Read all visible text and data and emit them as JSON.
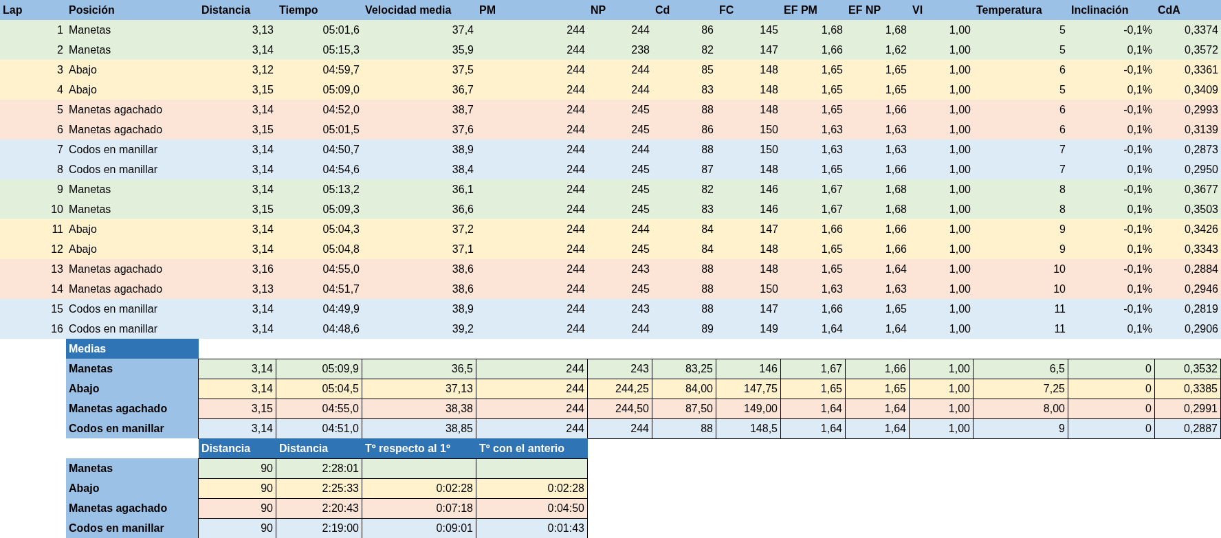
{
  "columns": [
    "Lap",
    "Posición",
    "Distancia",
    "Tiempo",
    "Velocidad media",
    "PM",
    "NP",
    "Cd",
    "FC",
    "EF PM",
    "EF NP",
    "VI",
    "Temperatura",
    "Inclinación",
    "CdA"
  ],
  "laps": [
    {
      "color": "#e2efda",
      "cells": [
        "1",
        "Manetas",
        "3,13",
        "05:01,6",
        "37,4",
        "244",
        "244",
        "86",
        "145",
        "1,68",
        "1,68",
        "1,00",
        "5",
        "-0,1%",
        "0,3374"
      ]
    },
    {
      "color": "#e2efda",
      "cells": [
        "2",
        "Manetas",
        "3,14",
        "05:15,3",
        "35,9",
        "244",
        "238",
        "82",
        "147",
        "1,66",
        "1,62",
        "1,00",
        "5",
        "0,1%",
        "0,3572"
      ]
    },
    {
      "color": "#fff2cc",
      "cells": [
        "3",
        "Abajo",
        "3,12",
        "04:59,7",
        "37,5",
        "244",
        "244",
        "85",
        "148",
        "1,65",
        "1,65",
        "1,00",
        "6",
        "-0,1%",
        "0,3361"
      ]
    },
    {
      "color": "#fff2cc",
      "cells": [
        "4",
        "Abajo",
        "3,15",
        "05:09,0",
        "36,7",
        "244",
        "244",
        "83",
        "148",
        "1,65",
        "1,65",
        "1,00",
        "5",
        "0,1%",
        "0,3409"
      ]
    },
    {
      "color": "#fce4d6",
      "cells": [
        "5",
        "Manetas agachado",
        "3,14",
        "04:52,0",
        "38,7",
        "244",
        "245",
        "88",
        "148",
        "1,65",
        "1,66",
        "1,00",
        "6",
        "-0,1%",
        "0,2993"
      ]
    },
    {
      "color": "#fce4d6",
      "cells": [
        "6",
        "Manetas agachado",
        "3,15",
        "05:01,5",
        "37,6",
        "244",
        "245",
        "86",
        "150",
        "1,63",
        "1,63",
        "1,00",
        "6",
        "0,1%",
        "0,3139"
      ]
    },
    {
      "color": "#ddebf7",
      "cells": [
        "7",
        "Codos en manillar",
        "3,14",
        "04:50,7",
        "38,9",
        "244",
        "244",
        "88",
        "150",
        "1,63",
        "1,63",
        "1,00",
        "7",
        "-0,1%",
        "0,2873"
      ]
    },
    {
      "color": "#ddebf7",
      "cells": [
        "8",
        "Codos en manillar",
        "3,14",
        "04:54,6",
        "38,4",
        "244",
        "245",
        "87",
        "148",
        "1,65",
        "1,66",
        "1,00",
        "7",
        "0,1%",
        "0,2950"
      ]
    },
    {
      "color": "#e2efda",
      "cells": [
        "9",
        "Manetas",
        "3,14",
        "05:13,2",
        "36,1",
        "244",
        "245",
        "82",
        "146",
        "1,67",
        "1,68",
        "1,00",
        "8",
        "-0,1%",
        "0,3677"
      ]
    },
    {
      "color": "#e2efda",
      "cells": [
        "10",
        "Manetas",
        "3,15",
        "05:09,3",
        "36,6",
        "244",
        "245",
        "83",
        "146",
        "1,67",
        "1,68",
        "1,00",
        "8",
        "0,1%",
        "0,3503"
      ]
    },
    {
      "color": "#fff2cc",
      "cells": [
        "11",
        "Abajo",
        "3,14",
        "05:04,3",
        "37,2",
        "244",
        "244",
        "84",
        "147",
        "1,66",
        "1,66",
        "1,00",
        "9",
        "-0,1%",
        "0,3426"
      ]
    },
    {
      "color": "#fff2cc",
      "cells": [
        "12",
        "Abajo",
        "3,14",
        "05:04,8",
        "37,1",
        "244",
        "245",
        "84",
        "148",
        "1,65",
        "1,66",
        "1,00",
        "9",
        "0,1%",
        "0,3343"
      ]
    },
    {
      "color": "#fce4d6",
      "cells": [
        "13",
        "Manetas agachado",
        "3,16",
        "04:55,0",
        "38,6",
        "244",
        "243",
        "88",
        "148",
        "1,65",
        "1,64",
        "1,00",
        "10",
        "-0,1%",
        "0,2884"
      ]
    },
    {
      "color": "#fce4d6",
      "cells": [
        "14",
        "Manetas agachado",
        "3,13",
        "04:51,7",
        "38,6",
        "244",
        "245",
        "88",
        "150",
        "1,63",
        "1,63",
        "1,00",
        "10",
        "0,1%",
        "0,2946"
      ]
    },
    {
      "color": "#ddebf7",
      "cells": [
        "15",
        "Codos en manillar",
        "3,14",
        "04:49,9",
        "38,9",
        "244",
        "243",
        "88",
        "147",
        "1,66",
        "1,65",
        "1,00",
        "11",
        "-0,1%",
        "0,2819"
      ]
    },
    {
      "color": "#ddebf7",
      "cells": [
        "16",
        "Codos en manillar",
        "3,14",
        "04:48,6",
        "39,2",
        "244",
        "244",
        "89",
        "149",
        "1,64",
        "1,64",
        "1,00",
        "11",
        "0,1%",
        "0,2906"
      ]
    }
  ],
  "medias": {
    "title": "Medias",
    "rows": [
      {
        "label": "Manetas",
        "color": "#e2efda",
        "values": [
          "3,14",
          "05:09,9",
          "36,5",
          "244",
          "243",
          "83,25",
          "146",
          "1,67",
          "1,66",
          "1,00",
          "6,5",
          "0",
          "0,3532"
        ]
      },
      {
        "label": "Abajo",
        "color": "#fff2cc",
        "values": [
          "3,14",
          "05:04,5",
          "37,13",
          "244",
          "244,25",
          "84,00",
          "147,75",
          "1,65",
          "1,65",
          "1,00",
          "7,25",
          "0",
          "0,3385"
        ]
      },
      {
        "label": "Manetas agachado",
        "color": "#fce4d6",
        "values": [
          "3,15",
          "04:55,0",
          "38,38",
          "244",
          "244,50",
          "87,50",
          "149,00",
          "1,64",
          "1,64",
          "1,00",
          "8,00",
          "0",
          "0,2991"
        ]
      },
      {
        "label": "Codos en manillar",
        "color": "#ddebf7",
        "values": [
          "3,14",
          "04:51,0",
          "38,85",
          "244",
          "244",
          "88",
          "148,5",
          "1,64",
          "1,64",
          "1,00",
          "9",
          "0",
          "0,2887"
        ]
      }
    ]
  },
  "totals": {
    "columns": [
      "Distancia",
      "Distancia",
      "Tº respecto al 1º",
      "Tº con el anterio"
    ],
    "rows": [
      {
        "label": "Manetas",
        "color": "#e2efda",
        "values": [
          "90",
          "2:28:01"
        ]
      },
      {
        "label": "Abajo",
        "color": "#fff2cc",
        "values": [
          "90",
          "2:25:33",
          "0:02:28",
          "0:02:28"
        ]
      },
      {
        "label": "Manetas agachado",
        "color": "#fce4d6",
        "values": [
          "90",
          "2:20:43",
          "0:07:18",
          "0:04:50"
        ]
      },
      {
        "label": "Codos en manillar",
        "color": "#ddebf7",
        "values": [
          "90",
          "2:19:00",
          "0:09:01",
          "0:01:43"
        ]
      }
    ]
  }
}
